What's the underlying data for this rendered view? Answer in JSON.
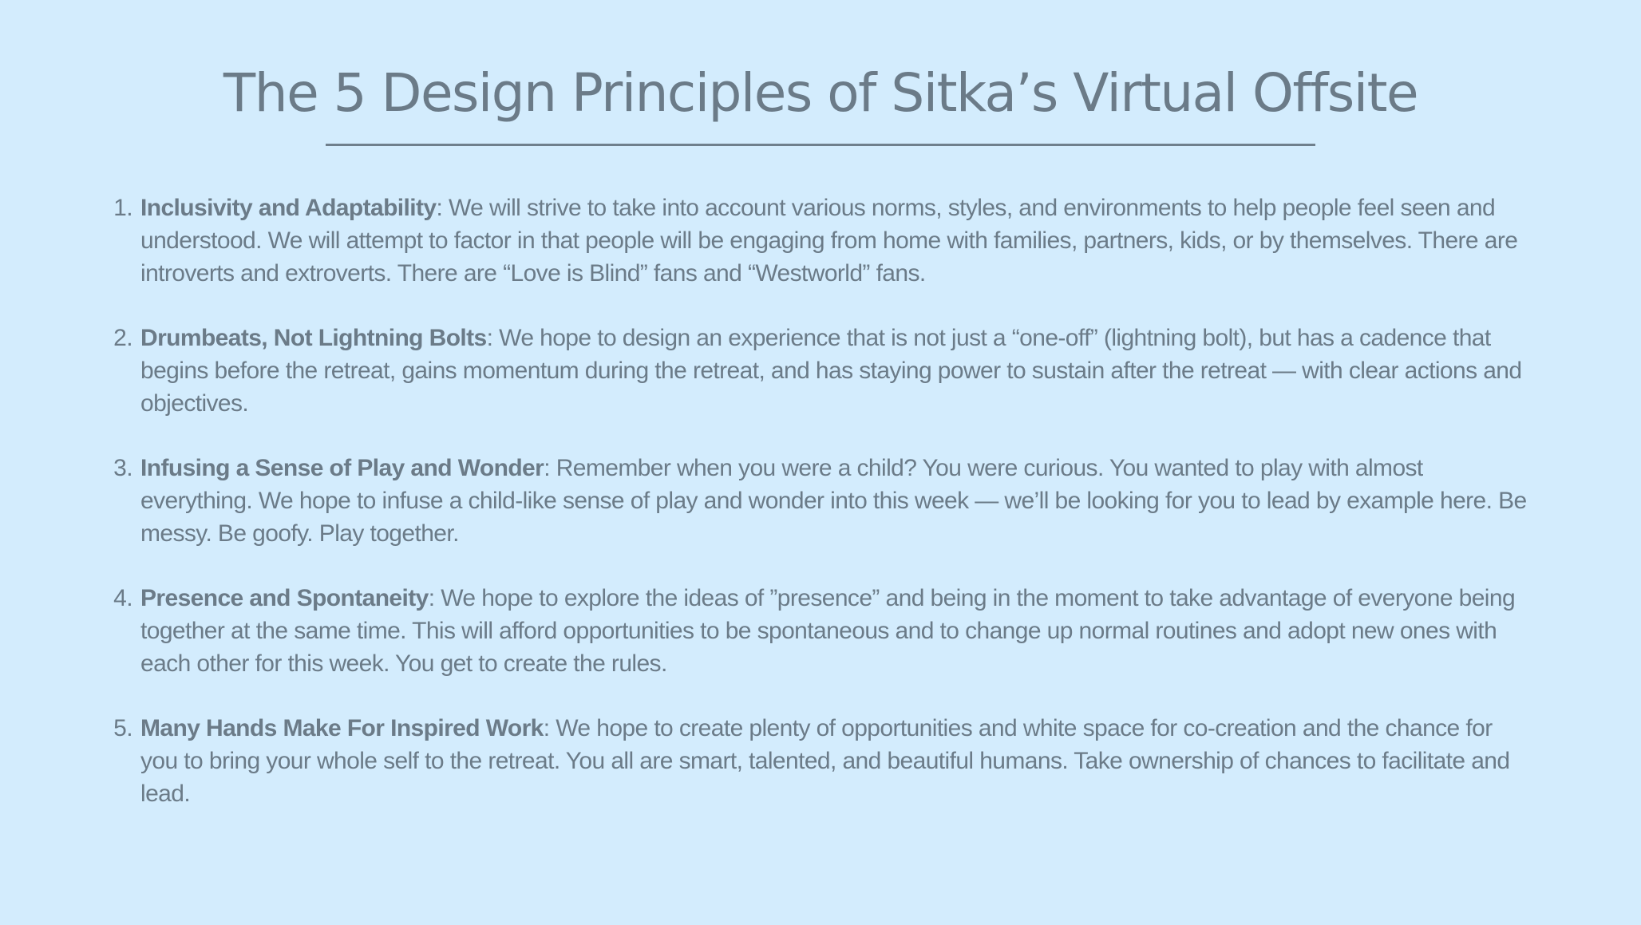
{
  "slide": {
    "title": "The 5 Design Principles of Sitka’s Virtual Offsite",
    "background_color": "#d3ecfd",
    "text_color": "#6b7b88"
  },
  "principles": [
    {
      "number": "1.",
      "term": "Inclusivity and Adaptability",
      "separator": ":",
      "text": " We will strive to take into account various norms, styles, and environments to help people feel seen and understood. We will attempt to factor in that people will be engaging from home with families, partners, kids, or by themselves. There are introverts and extroverts. There are “Love is Blind” fans and “Westworld” fans."
    },
    {
      "number": "2.",
      "term": "Drumbeats, Not Lightning Bolts",
      "separator": ":",
      "text": " We hope to design an experience that is not just a “one-off” (lightning bolt), but has a cadence that begins before the retreat, gains momentum during the retreat, and has staying power to sustain after the retreat — with clear actions and objectives."
    },
    {
      "number": "3.",
      "term": "Infusing a Sense of Play and Wonder",
      "separator": ":",
      "text": " Remember when you were a child? You were curious. You wanted to play with almost everything. We hope to infuse a child-like sense of play and wonder into this week — we’ll be looking for you to lead by example here. Be messy. Be goofy. Play together."
    },
    {
      "number": "4.",
      "term": "Presence and Spontaneity",
      "separator": ":",
      "text": " We hope to explore the ideas of ”presence” and being in the moment to take advantage of everyone being together at the same time. This will afford opportunities to be spontaneous and to change up normal routines and adopt new ones with each other for this week. You get to create the rules."
    },
    {
      "number": "5.",
      "term": "Many Hands Make For Inspired Work",
      "separator": ":",
      "text": " We hope to create plenty of opportunities and white space for co-creation and the chance for you to bring your whole self to the retreat. You all are smart, talented, and beautiful humans. Take ownership of chances to facilitate and lead."
    }
  ]
}
